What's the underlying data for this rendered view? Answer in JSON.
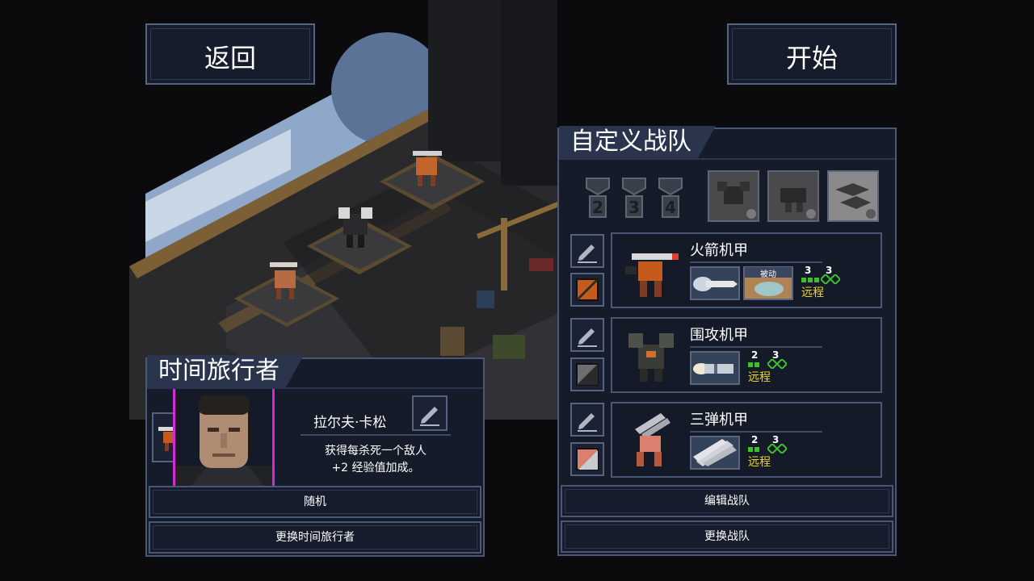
{
  "nav": {
    "back_label": "返回",
    "start_label": "开始"
  },
  "pilot_panel": {
    "title": "时间旅行者",
    "pilot_name": "拉尔夫·卡松",
    "ability_line1": "获得每杀死一个敌人",
    "ability_line2": "+2 经验值加成。",
    "random_label": "随机",
    "change_label": "更换时间旅行者"
  },
  "squad_panel": {
    "title": "自定义战队",
    "medals": [
      "2",
      "3",
      "4"
    ],
    "mechs": [
      {
        "name": "火箭机甲",
        "passive_label": "被动",
        "move": "3",
        "hp": "3",
        "range": "远程",
        "color_a": "#c45a1c",
        "color_b": "#2a2a2a"
      },
      {
        "name": "围攻机甲",
        "move": "2",
        "hp": "3",
        "range": "远程",
        "color_a": "#6e6e6e",
        "color_b": "#2b2b2b"
      },
      {
        "name": "三弹机甲",
        "move": "2",
        "hp": "3",
        "range": "远程",
        "color_a": "#d9806e",
        "color_b": "#c8cbd0"
      }
    ],
    "edit_label": "编辑战队",
    "change_label": "更换战队"
  },
  "colors": {
    "accent_yellow": "#f2d51f",
    "accent_green": "#3ec22c",
    "pilot_border": "#d22bd6"
  }
}
